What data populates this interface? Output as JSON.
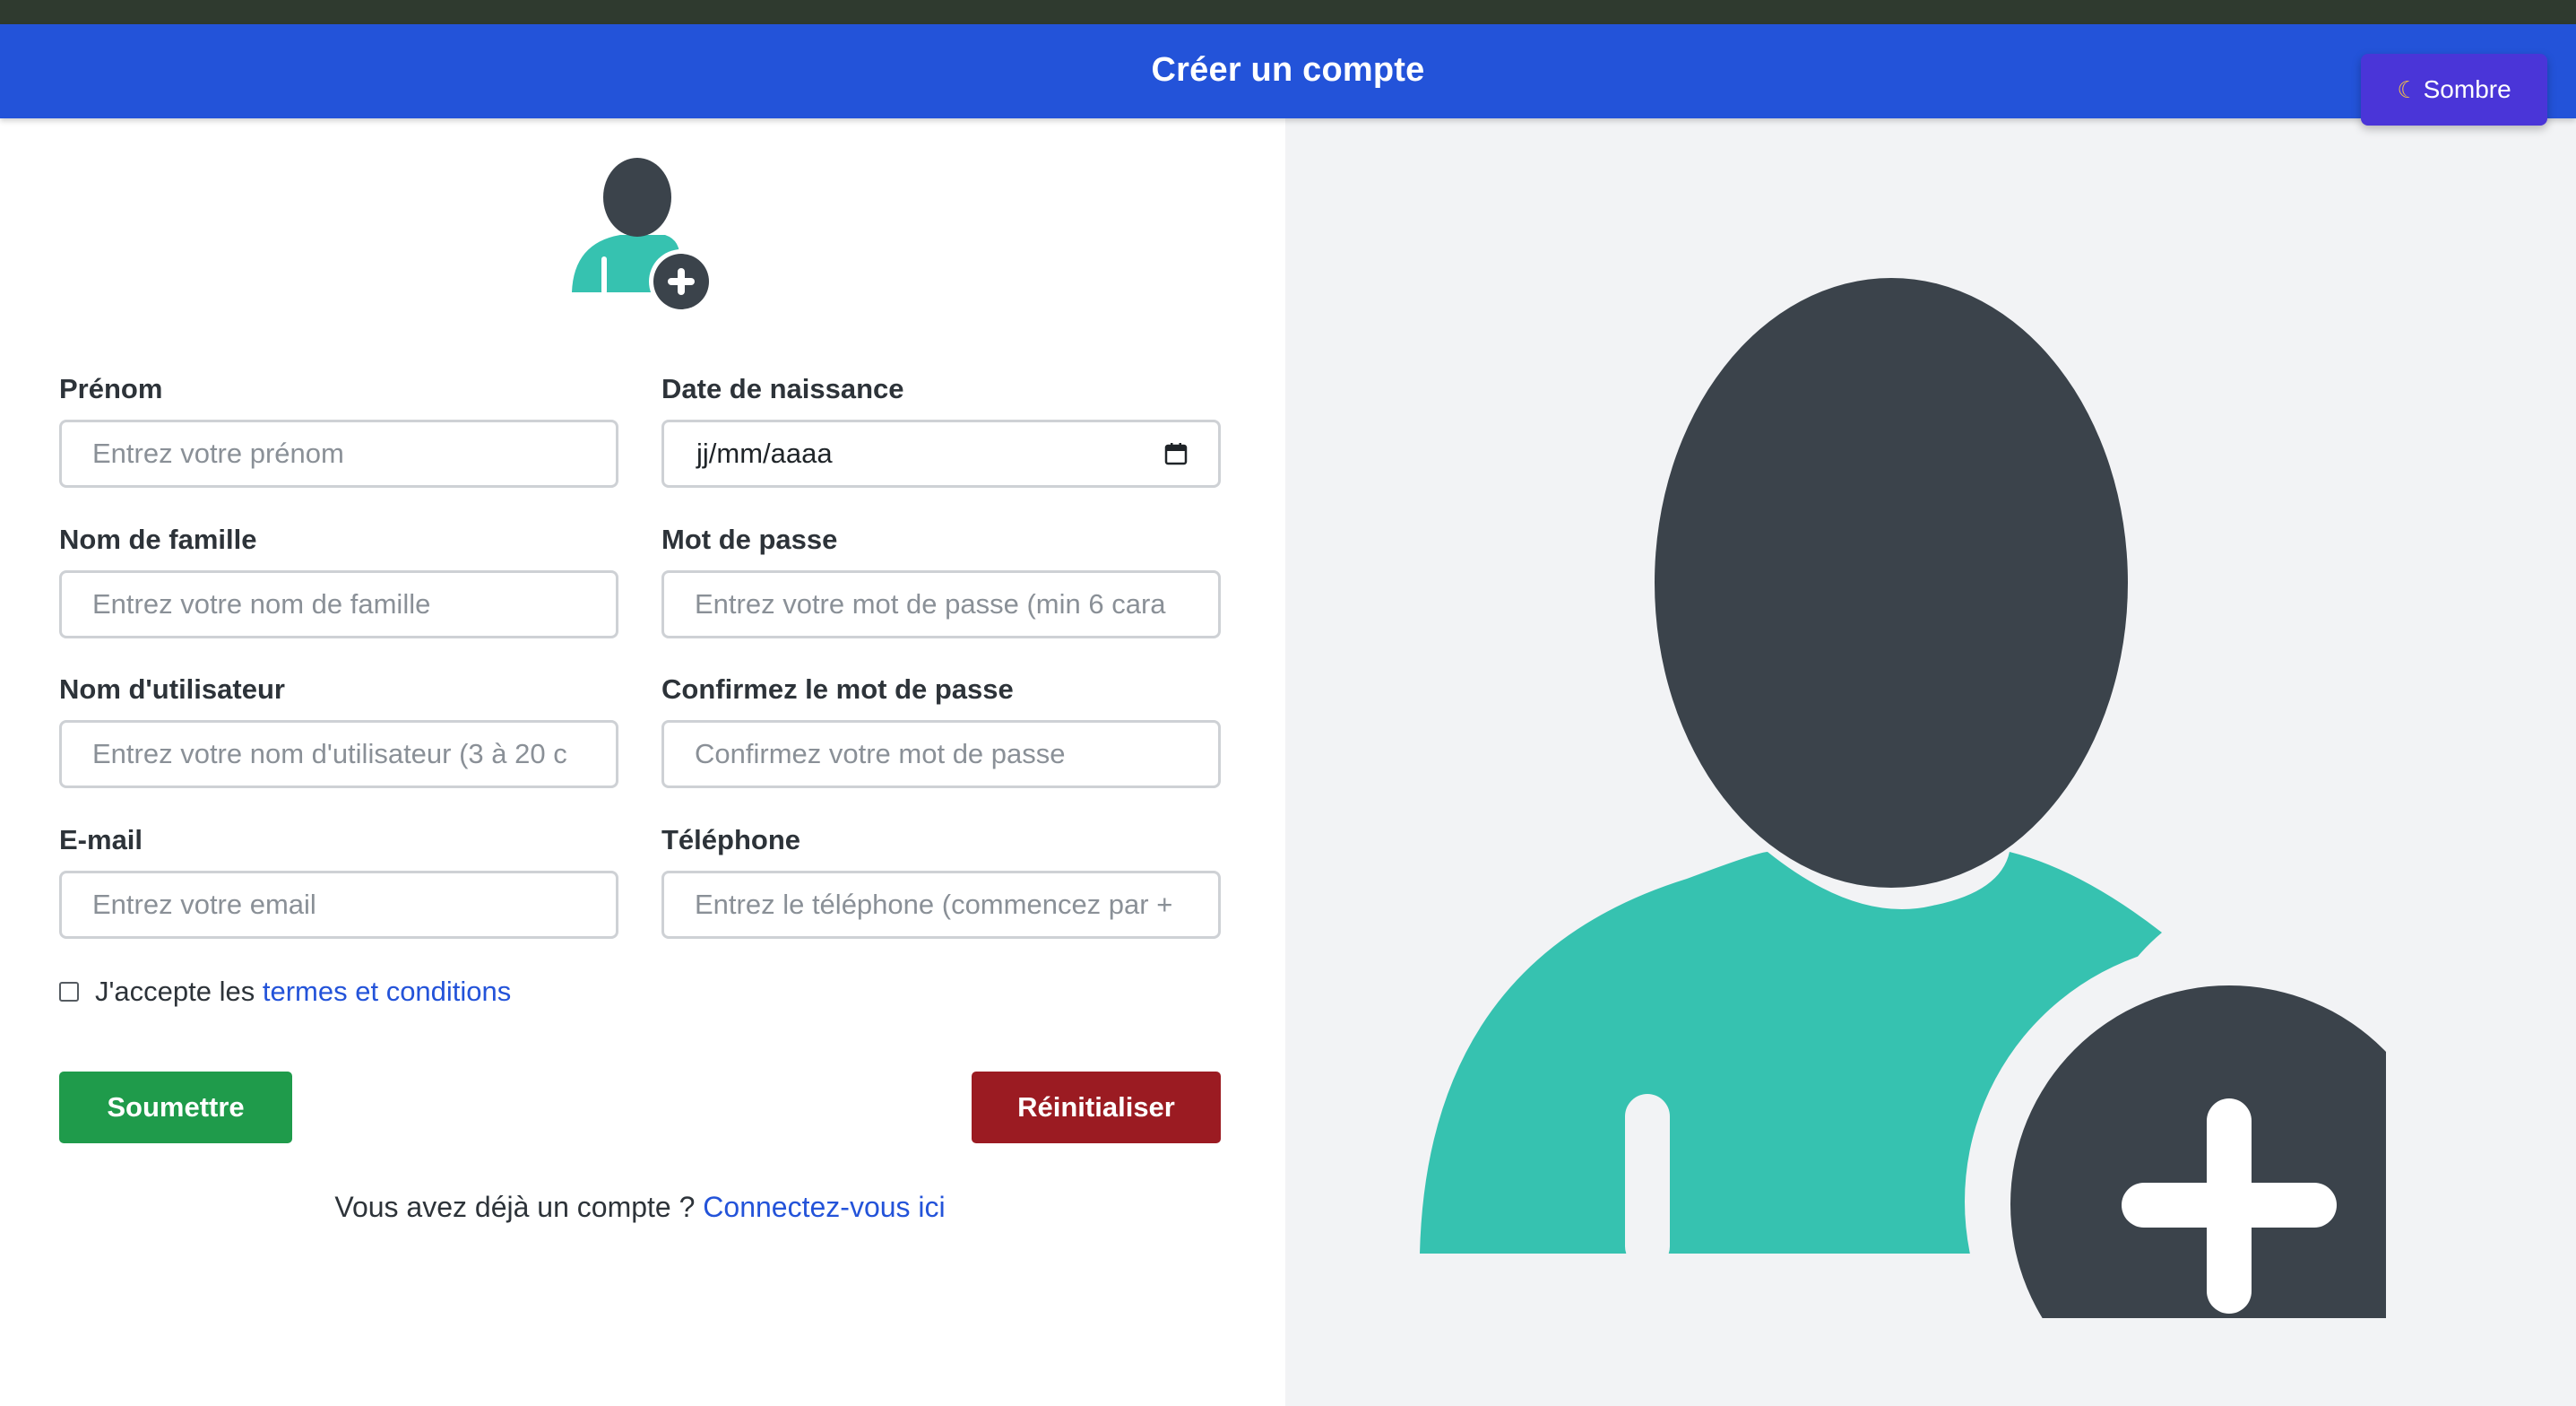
{
  "header": {
    "title": "Créer un compte",
    "theme_toggle": {
      "icon": "moon-icon",
      "label": "Sombre"
    }
  },
  "form": {
    "first_name": {
      "label": "Prénom",
      "placeholder": "Entrez votre prénom",
      "value": ""
    },
    "last_name": {
      "label": "Nom de famille",
      "placeholder": "Entrez votre nom de famille",
      "value": ""
    },
    "username": {
      "label": "Nom d'utilisateur",
      "placeholder": "Entrez votre nom d'utilisateur (3 à 20 c",
      "value": ""
    },
    "email": {
      "label": "E-mail",
      "placeholder": "Entrez votre email",
      "value": ""
    },
    "birth_date": {
      "label": "Date de naissance",
      "value": "jj/mm/aaaa",
      "icon": "calendar-icon"
    },
    "password": {
      "label": "Mot de passe",
      "placeholder": "Entrez votre mot de passe (min 6 cara",
      "value": ""
    },
    "confirm_password": {
      "label": "Confirmez le mot de passe",
      "placeholder": "Confirmez votre mot de passe",
      "value": ""
    },
    "phone": {
      "label": "Téléphone",
      "placeholder": "Entrez le téléphone (commencez par +",
      "value": ""
    },
    "terms": {
      "checked": false,
      "prefix": "J'accepte les",
      "link": "termes et conditions"
    },
    "submit_label": "Soumettre",
    "reset_label": "Réinitialiser",
    "login_prompt": {
      "text": "Vous avez déjà un compte ?",
      "link": "Connectez-vous ici"
    }
  },
  "illustration": {
    "icon": "add-user-icon",
    "colors": {
      "head": "#3b434b",
      "body": "#36c2b0",
      "plus_circle": "#3b434b",
      "plus": "#ffffff"
    }
  },
  "colors": {
    "header_bg": "#2353d9",
    "theme_button_bg": "#4a35d8",
    "submit_bg": "#1f9b4b",
    "reset_bg": "#9b1b22",
    "link": "#2353d9",
    "right_panel_bg": "#f2f3f5"
  }
}
